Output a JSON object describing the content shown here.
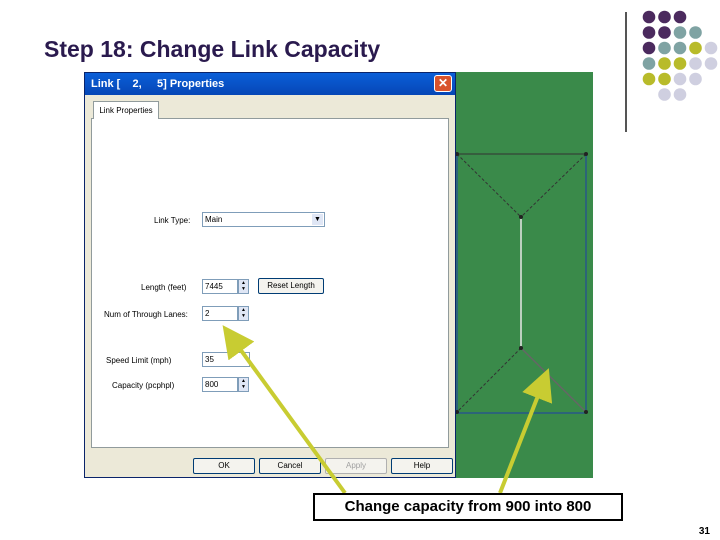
{
  "slide": {
    "title": "Step 18: Change Link Capacity",
    "page_number": "31",
    "callout_text": "Change capacity from 900 into 800",
    "colors": {
      "purple": "#4b2a5e",
      "teal": "#7fa3a3",
      "olive": "#b8bb2a",
      "lavender": "#cfcfe0",
      "arrow": "#c8cc32",
      "map_green": "#3a8a4a"
    }
  },
  "dialog": {
    "title": "Link [    2,     5] Properties",
    "close_icon": "close-icon",
    "tab_label": "Link Properties",
    "fields": {
      "link_type_label": "Link Type:",
      "link_type_value": "Main",
      "length_label": "Length (feet)",
      "length_value": "7445",
      "reset_length_label": "Reset Length",
      "through_lanes_label": "Num of Through Lanes:",
      "through_lanes_value": "2",
      "speed_limit_label": "Speed Limit (mph)",
      "speed_limit_value": "35",
      "capacity_label": "Capacity (pcphpl)",
      "capacity_value": "800"
    },
    "buttons": {
      "ok": "OK",
      "cancel": "Cancel",
      "apply": "Apply",
      "help": "Help"
    }
  }
}
